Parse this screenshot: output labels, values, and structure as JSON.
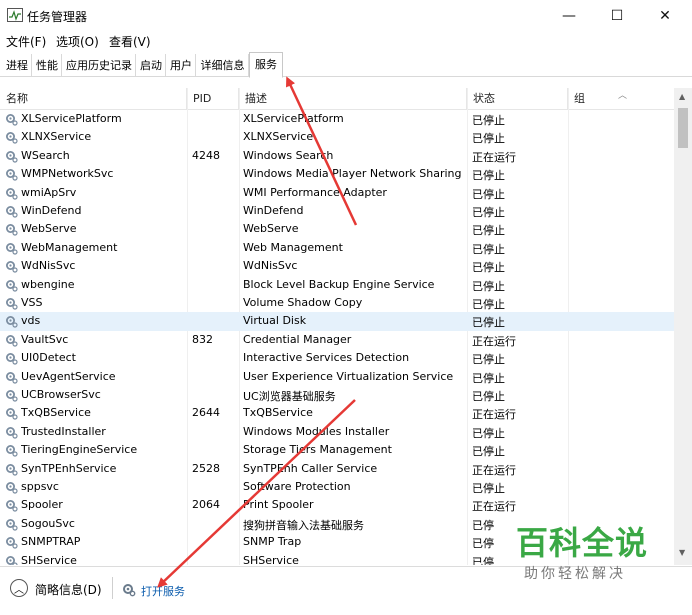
{
  "window": {
    "title": "任务管理器",
    "minimize": "—",
    "maximize": "☐",
    "close": "✕"
  },
  "menu": [
    "文件(F)",
    "选项(O)",
    "查看(V)"
  ],
  "tabs": [
    "进程",
    "性能",
    "应用历史记录",
    "启动",
    "用户",
    "详细信息",
    "服务"
  ],
  "active_tab": "服务",
  "columns": [
    "名称",
    "PID",
    "描述",
    "状态",
    "组"
  ],
  "services": [
    {
      "name": "XLServicePlatform",
      "pid": "",
      "desc": "XLServicePlatform",
      "status": "已停止"
    },
    {
      "name": "XLNXService",
      "pid": "",
      "desc": "XLNXService",
      "status": "已停止"
    },
    {
      "name": "WSearch",
      "pid": "4248",
      "desc": "Windows Search",
      "status": "正在运行"
    },
    {
      "name": "WMPNetworkSvc",
      "pid": "",
      "desc": "Windows Media Player Network Sharing ...",
      "status": "已停止"
    },
    {
      "name": "wmiApSrv",
      "pid": "",
      "desc": "WMI Performance Adapter",
      "status": "已停止"
    },
    {
      "name": "WinDefend",
      "pid": "",
      "desc": "WinDefend",
      "status": "已停止"
    },
    {
      "name": "WebServe",
      "pid": "",
      "desc": "WebServe",
      "status": "已停止"
    },
    {
      "name": "WebManagement",
      "pid": "",
      "desc": "Web Management",
      "status": "已停止"
    },
    {
      "name": "WdNisSvc",
      "pid": "",
      "desc": "WdNisSvc",
      "status": "已停止"
    },
    {
      "name": "wbengine",
      "pid": "",
      "desc": "Block Level Backup Engine Service",
      "status": "已停止"
    },
    {
      "name": "VSS",
      "pid": "",
      "desc": "Volume Shadow Copy",
      "status": "已停止"
    },
    {
      "name": "vds",
      "pid": "",
      "desc": "Virtual Disk",
      "status": "已停止"
    },
    {
      "name": "VaultSvc",
      "pid": "832",
      "desc": "Credential Manager",
      "status": "正在运行"
    },
    {
      "name": "UI0Detect",
      "pid": "",
      "desc": "Interactive Services Detection",
      "status": "已停止"
    },
    {
      "name": "UevAgentService",
      "pid": "",
      "desc": "User Experience Virtualization Service",
      "status": "已停止"
    },
    {
      "name": "UCBrowserSvc",
      "pid": "",
      "desc": "UC浏览器基础服务",
      "status": "已停止"
    },
    {
      "name": "TxQBService",
      "pid": "2644",
      "desc": "TxQBService",
      "status": "正在运行"
    },
    {
      "name": "TrustedInstaller",
      "pid": "",
      "desc": "Windows Modules Installer",
      "status": "已停止"
    },
    {
      "name": "TieringEngineService",
      "pid": "",
      "desc": "Storage Tiers Management",
      "status": "已停止"
    },
    {
      "name": "SynTPEnhService",
      "pid": "2528",
      "desc": "SynTPEnh Caller Service",
      "status": "正在运行"
    },
    {
      "name": "sppsvc",
      "pid": "",
      "desc": "Software Protection",
      "status": "已停止"
    },
    {
      "name": "Spooler",
      "pid": "2064",
      "desc": "Print Spooler",
      "status": "正在运行"
    },
    {
      "name": "SogouSvc",
      "pid": "",
      "desc": "搜狗拼音输入法基础服务",
      "status": "已停"
    },
    {
      "name": "SNMPTRAP",
      "pid": "",
      "desc": "SNMP Trap",
      "status": "已停"
    },
    {
      "name": "SHService",
      "pid": "",
      "desc": "SHService",
      "status": "已停"
    }
  ],
  "selected_service": "vds",
  "footer": {
    "collapse_label": "简略信息(D)",
    "open_services_label": "打开服务"
  },
  "watermark": {
    "title": "百科全说",
    "subtitle": "助你轻松解决"
  },
  "colors": {
    "selection": "#e5f1fb",
    "link": "#0b5cad",
    "arrow": "#e53935",
    "watermark": "#3aa845"
  }
}
